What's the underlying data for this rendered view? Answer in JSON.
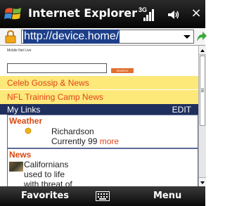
{
  "titlebar": {
    "title": "Internet Explorer",
    "network": "3G",
    "close": "×"
  },
  "addressbar": {
    "url": "http://device.home/"
  },
  "page": {
    "logo_text": "Mobile Net Live",
    "search_button": "SEARCH",
    "promo_links": [
      "Celeb Gossip & News",
      "NFL Training Camp News"
    ],
    "mylinks": {
      "title": "My Links",
      "edit": "EDIT"
    },
    "weather": {
      "title": "Weather",
      "city": "Richardson",
      "current_prefix": "Currently 99",
      "more": "more"
    },
    "news": {
      "title": "News",
      "headline": "Californians used to life with threat of 'The Big One'"
    }
  },
  "softkeys": {
    "left": "Favorites",
    "right": "Menu"
  },
  "colors": {
    "titlebar": "#111111",
    "promo_band": "#fde87a",
    "link_orange": "#e0451a",
    "mylinks_bar": "#1f2f5d",
    "url_highlight": "#1d3f8a"
  }
}
